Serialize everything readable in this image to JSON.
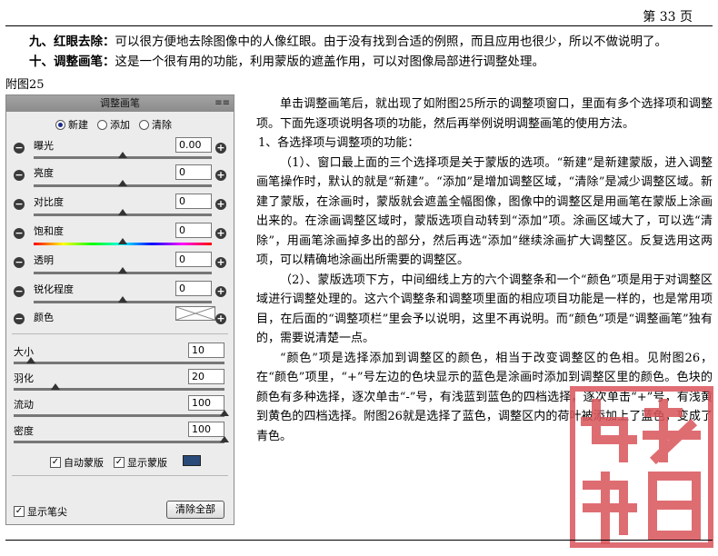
{
  "page": {
    "number": "第 33 页"
  },
  "intro": {
    "p9_title": "九、红眼去除：",
    "p9_text": "可以很方便地去除图像中的人像红眼。由于没有找到合适的例照，而且应用也很少，所以不做说明了。",
    "p10_title": "十、调整画笔：",
    "p10_text": "这是一个很有用的功能，利用蒙版的遮盖作用，可以对图像局部进行调整处理。",
    "figure_label": "附图25"
  },
  "panel": {
    "title": "调整画笔",
    "menu_icon": "panel-menu-icon",
    "modes": [
      {
        "label": "新建",
        "selected": true
      },
      {
        "label": "添加",
        "selected": false
      },
      {
        "label": "清除",
        "selected": false
      }
    ],
    "adjustments": [
      {
        "label": "曝光",
        "value": "0.00",
        "level": 0.5
      },
      {
        "label": "亮度",
        "value": "0",
        "level": 0.5
      },
      {
        "label": "对比度",
        "value": "0",
        "level": 0.5
      },
      {
        "label": "饱和度",
        "value": "0",
        "level": 0.5
      },
      {
        "label": "透明",
        "value": "0",
        "level": 0.5
      },
      {
        "label": "锐化程度",
        "value": "0",
        "level": 0.5
      }
    ],
    "color_label": "颜色",
    "brush": [
      {
        "label": "大小",
        "value": "10",
        "level": 0.08
      },
      {
        "label": "羽化",
        "value": "20",
        "level": 0.2
      },
      {
        "label": "流动",
        "value": "100",
        "level": 1.0
      },
      {
        "label": "密度",
        "value": "100",
        "level": 1.0
      }
    ],
    "auto_mask_label": "自动蒙版",
    "show_mask_label": "显示蒙版",
    "mask_color": "#2a4a7a",
    "show_pin_label": "显示笔尖",
    "clear_all_label": "清除全部"
  },
  "body": {
    "para1": "单击调整画笔后，就出现了如附图25所示的调整项窗口，里面有多个选择项和调整项。下面先逐项说明各项的功能，然后再举例说明调整画笔的使用方法。",
    "heading1": "1、各选择项与调整项的功能：",
    "para2": "（1）、窗口最上面的三个选择项是关于蒙版的选项。“新建”是新建蒙版，进入调整画笔操作时，默认的就是“新建”。“添加”是增加调整区域，“清除”是减少调整区域。新建了蒙版，在涂画时，蒙版就会遮盖全幅图像，图像中的调整区是用画笔在蒙版上涂画出来的。在涂画调整区域时，蒙版选项自动转到“添加”项。涂画区域大了，可以选“清除”，用画笔涂画掉多出的部分，然后再选“添加”继续涂画扩大调整区。反复选用这两项，可以精确地涂画出所需要的调整区。",
    "para3": "（2）、蒙版选项下方，中间细线上方的六个调整条和一个“颜色”项是用于对调整区域进行调整处理的。这六个调整条和调整项里面的相应项目功能是一样的，也是常用项目，在后面的“调整项栏”里会予以说明，这里不再说明。而“颜色”项是“调整画笔”独有的，需要说清楚一点。",
    "para4": "“颜色”项是选择添加到调整区的颜色，相当于改变调整区的色相。见附图26，在“颜色”项里，“+”号左边的色块显示的蓝色是涂画时添加到调整区里的颜色。色块的颜色有多种选择，逐次单击“-”号，有浅蓝到蓝色的四档选择，逐次单击“+”号，有浅黄到黄色的四档选择。附图26就是选择了蓝色，调整区内的荷叶被添加上了蓝色，变成了青色。"
  },
  "seal": {
    "color": "#d9545a"
  }
}
